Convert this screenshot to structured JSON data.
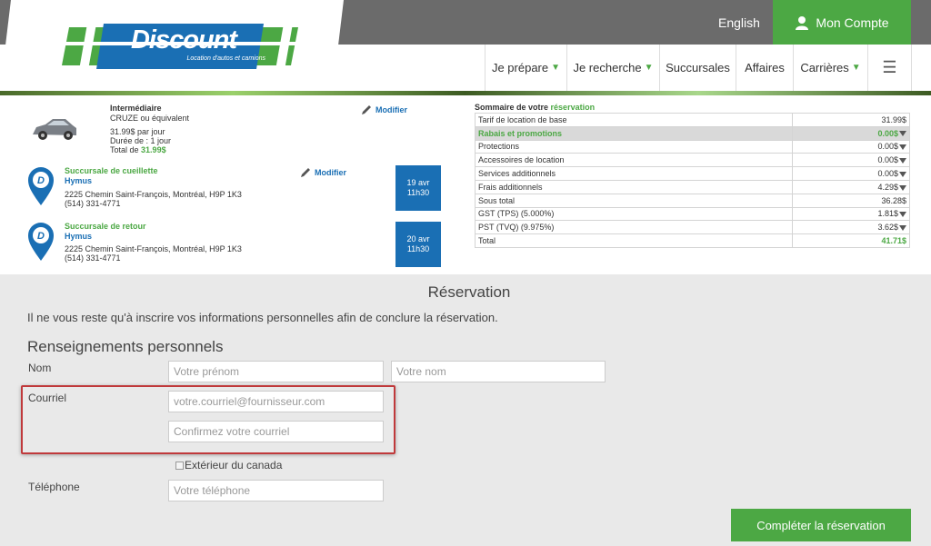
{
  "header": {
    "logo_text": "Discount",
    "logo_tagline": "Location d'autos et camions",
    "lang_link": "English",
    "account_label": "Mon Compte",
    "nav": [
      {
        "label": "Je prépare"
      },
      {
        "label": "Je recherche"
      },
      {
        "label": "Succursales"
      },
      {
        "label": "Affaires"
      },
      {
        "label": "Carrières"
      }
    ],
    "colors": {
      "brand_green": "#4ca844",
      "brand_blue": "#1a6fb4",
      "topbar": "#6b6b6b"
    }
  },
  "vehicle": {
    "class": "Intermédiaire",
    "model": "CRUZE ou équivalent",
    "price_per_day": "31.99$ par jour",
    "duration": "Durée de : 1 jour",
    "total_label": "Total de",
    "total_value": "31.99$",
    "modify": "Modifier"
  },
  "pickup": {
    "title": "Succursale de cueillette",
    "name": "Hymus",
    "address": "2225 Chemin Saint-François, Montréal, H9P 1K3",
    "phone": "(514) 331-4771",
    "date_line1": "19 avr",
    "date_line2": "11h30",
    "modify": "Modifier"
  },
  "dropoff": {
    "title": "Succursale de retour",
    "name": "Hymus",
    "address": "2225 Chemin Saint-François, Montréal, H9P 1K3",
    "phone": "(514) 331-4771",
    "date_line1": "20 avr",
    "date_line2": "11h30"
  },
  "summary": {
    "title_a": "Sommaire de votre",
    "title_b": "réservation",
    "rows": [
      {
        "label": "Tarif de location de base",
        "value": "31.99$"
      },
      {
        "label": "Rabais et promotions",
        "value": "0.00$"
      },
      {
        "label": "Protections",
        "value": "0.00$"
      },
      {
        "label": "Accessoires de location",
        "value": "0.00$"
      },
      {
        "label": "Services additionnels",
        "value": "0.00$"
      },
      {
        "label": "Frais additionnels",
        "value": "4.29$"
      },
      {
        "label": "Sous total",
        "value": "36.28$"
      },
      {
        "label": "GST (TPS) (5.000%)",
        "value": "1.81$"
      },
      {
        "label": "PST (TVQ) (9.975%)",
        "value": "3.62$"
      },
      {
        "label": "Total",
        "value": "41.71$"
      }
    ]
  },
  "form": {
    "title": "Réservation",
    "intro": "Il ne vous reste qu'à inscrire vos informations personnelles afin de conclure la réservation.",
    "section": "Renseignements personnels",
    "name_label": "Nom",
    "first_name_placeholder": "Votre prénom",
    "last_name_placeholder": "Votre nom",
    "email_label": "Courriel",
    "email_placeholder": "votre.courriel@fournisseur.com",
    "email_confirm_placeholder": "Confirmez votre courriel",
    "outside_canada": "Extérieur du canada",
    "phone_label": "Téléphone",
    "phone_placeholder": "Votre téléphone",
    "submit": "Compléter la réservation"
  }
}
